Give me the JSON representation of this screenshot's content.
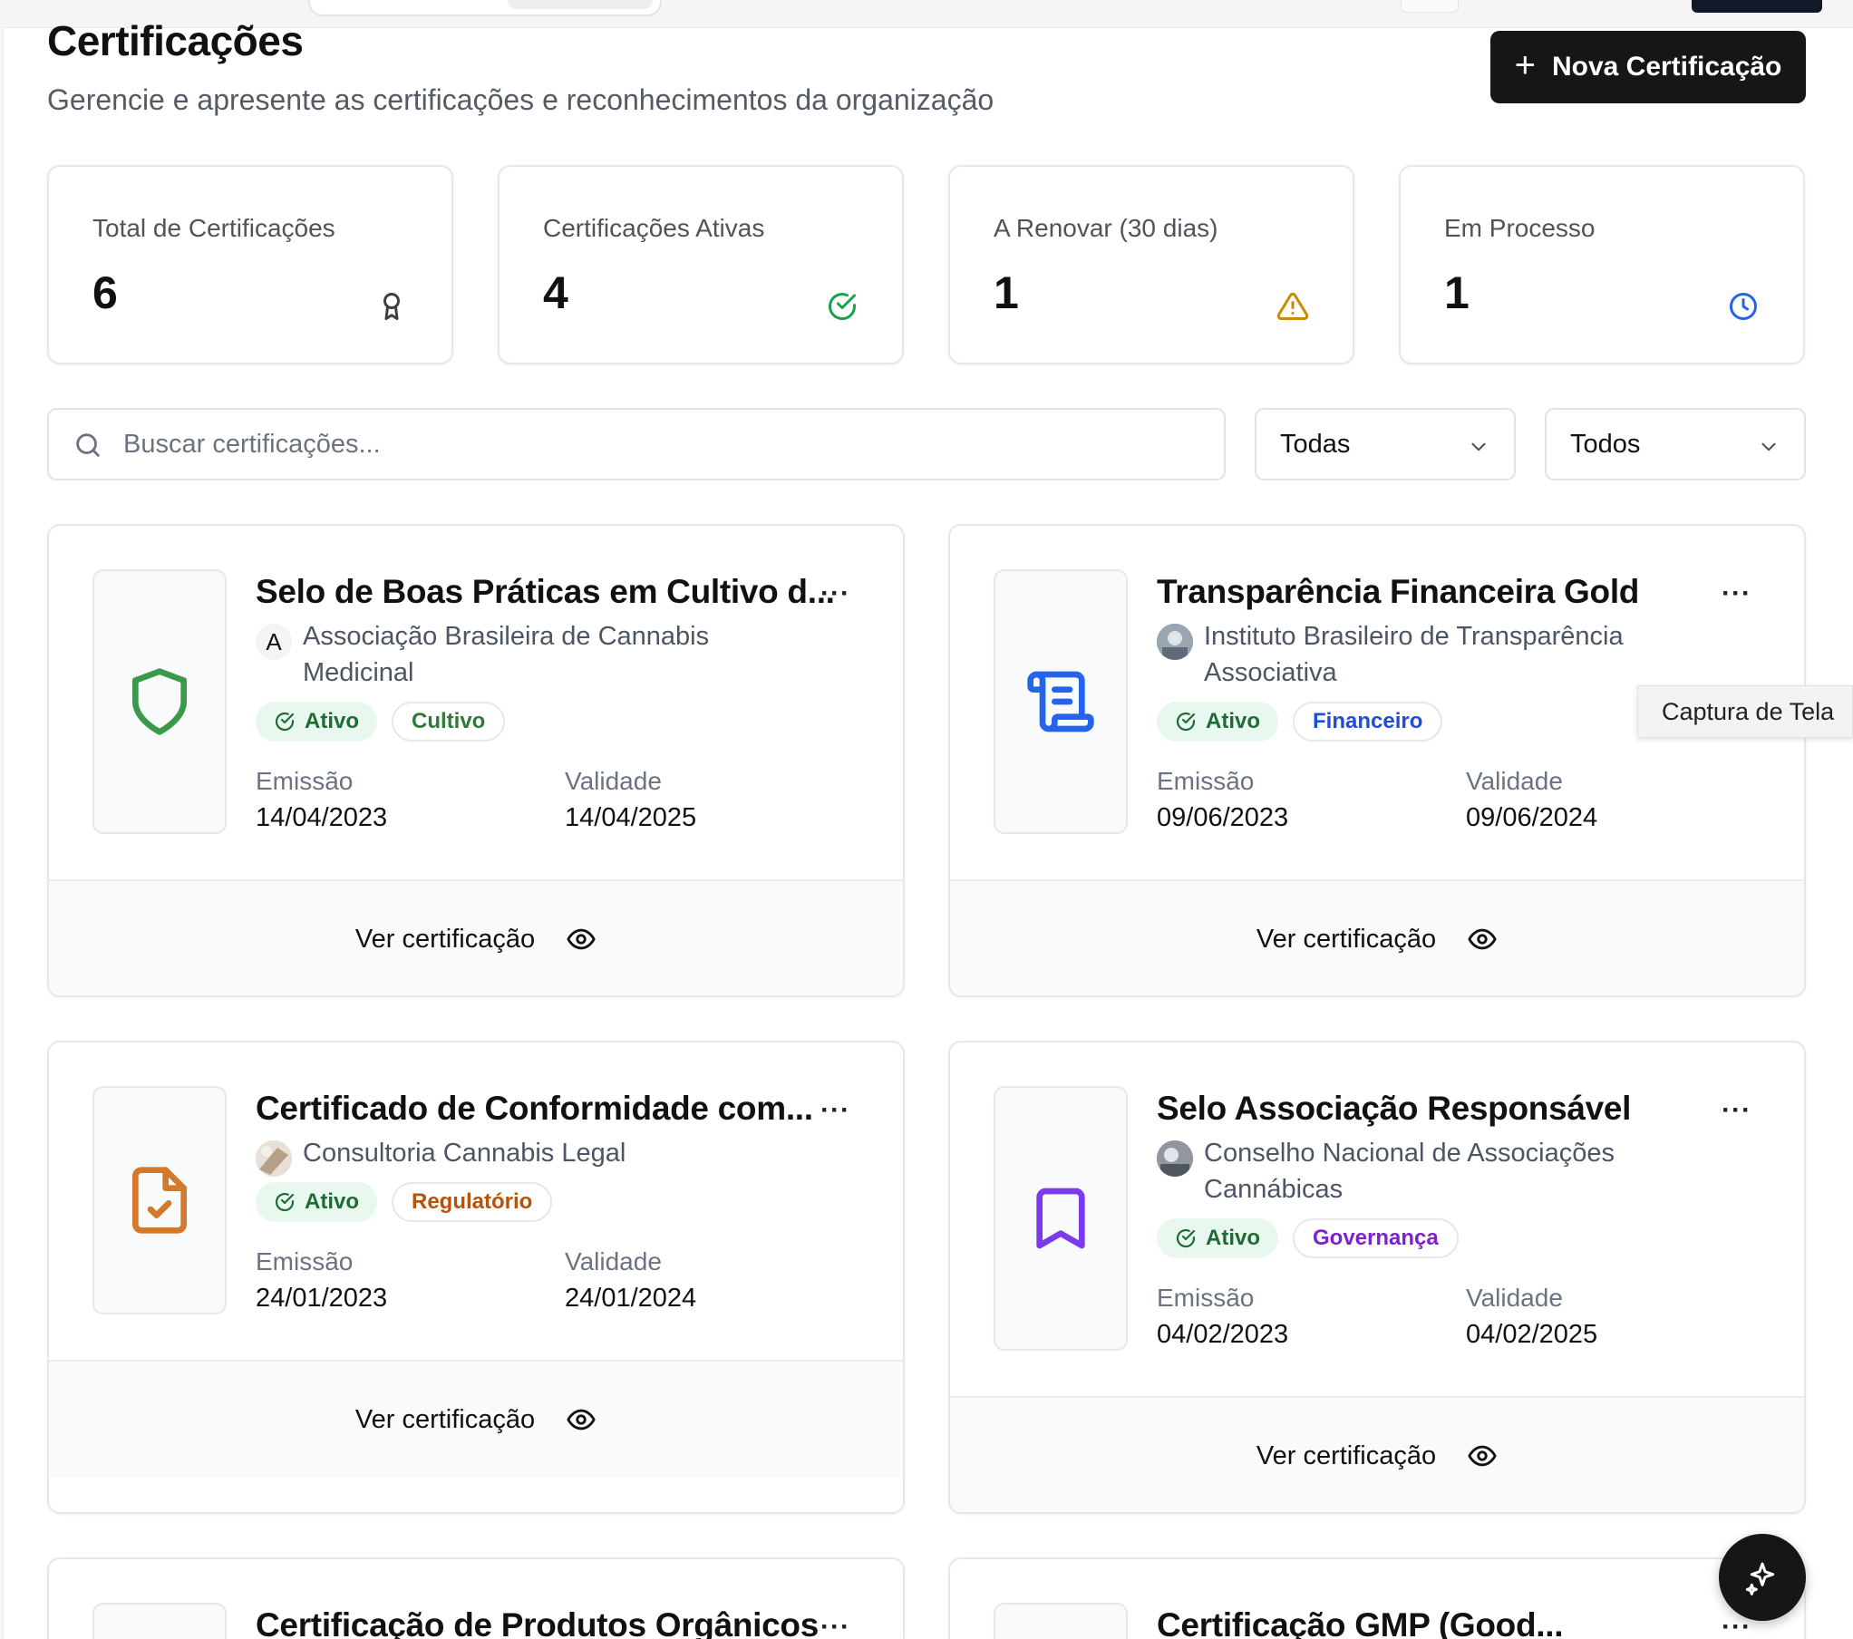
{
  "header": {
    "title": "Certificações",
    "subtitle": "Gerencie e apresente as certificações e reconhecimentos da organização",
    "new_button_label": "Nova Certificação"
  },
  "stats": [
    {
      "label": "Total de Certificações",
      "value": "6",
      "icon": "award-icon",
      "color": "#3f3f46"
    },
    {
      "label": "Certificações Ativas",
      "value": "4",
      "icon": "check-circle-icon",
      "color": "#16a34a"
    },
    {
      "label": "A Renovar (30 dias)",
      "value": "1",
      "icon": "warning-triangle-icon",
      "color": "#ca8a04"
    },
    {
      "label": "Em Processo",
      "value": "1",
      "icon": "clock-icon",
      "color": "#2563eb"
    }
  ],
  "filters": {
    "search_placeholder": "Buscar certificações...",
    "type_filter_value": "Todas",
    "status_filter_value": "Todos"
  },
  "cards": [
    {
      "title": "Selo de Boas Práticas em Cultivo d...",
      "issuer": "Associação Brasileira de Cannabis Medicinal",
      "avatar_letter": "A",
      "status": "Ativo",
      "category": "Cultivo",
      "category_color": "#2f7a3a",
      "icon": "shield-icon",
      "icon_color": "#3a9a4a",
      "emission_label": "Emissão",
      "emission": "14/04/2023",
      "validity_label": "Validade",
      "validity": "14/04/2025",
      "view_label": "Ver certificação"
    },
    {
      "title": "Transparência Financeira Gold",
      "issuer": "Instituto Brasileiro de Transparência Associativa",
      "status": "Ativo",
      "category": "Financeiro",
      "category_color": "#1d4ed8",
      "icon": "scroll-icon",
      "icon_color": "#2563eb",
      "emission_label": "Emissão",
      "emission": "09/06/2023",
      "validity_label": "Validade",
      "validity": "09/06/2024",
      "view_label": "Ver certificação"
    },
    {
      "title": "Certificado de Conformidade com...",
      "issuer": "Consultoria Cannabis Legal",
      "status": "Ativo",
      "category": "Regulatório",
      "category_color": "#b45309",
      "icon": "file-check-icon",
      "icon_color": "#d4782c",
      "emission_label": "Emissão",
      "emission": "24/01/2023",
      "validity_label": "Validade",
      "validity": "24/01/2024",
      "view_label": "Ver certificação"
    },
    {
      "title": "Selo Associação Responsável",
      "issuer": "Conselho Nacional de Associações Cannábicas",
      "status": "Ativo",
      "category": "Governança",
      "category_color": "#7e22ce",
      "icon": "bookmark-icon",
      "icon_color": "#7c3aed",
      "emission_label": "Emissão",
      "emission": "04/02/2023",
      "validity_label": "Validade",
      "validity": "04/02/2025",
      "view_label": "Ver certificação"
    },
    {
      "title": "Certificação de Produtos Orgânicos"
    },
    {
      "title": "Certificação GMP (Good..."
    }
  ],
  "tooltip": "Captura de Tela"
}
